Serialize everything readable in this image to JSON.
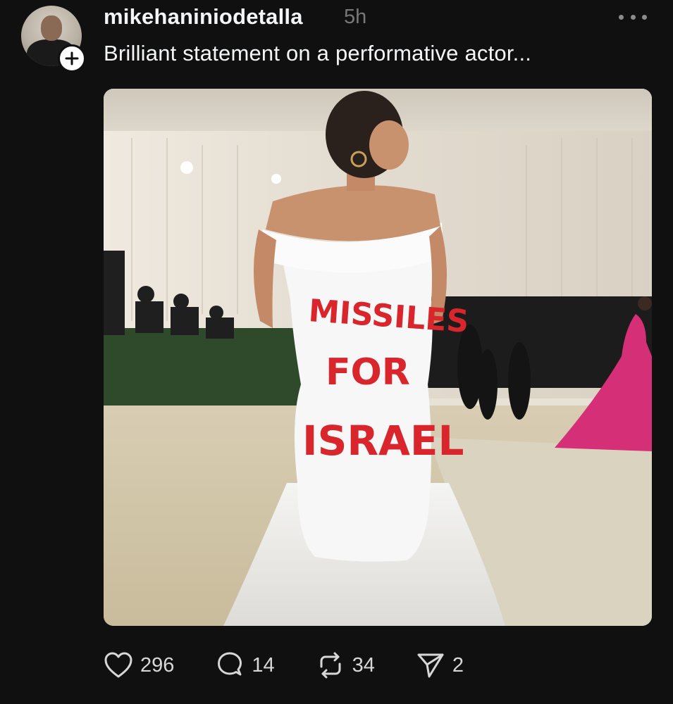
{
  "post": {
    "username": "mikehaniniodetalla",
    "time_ago": "5h",
    "caption": "Brilliant statement on a performative actor...",
    "image": {
      "dress_text_line1": "MISSILES",
      "dress_text_line2": "FOR",
      "dress_text_line3": "ISRAEL"
    }
  },
  "actions": {
    "likes": "296",
    "replies": "14",
    "reposts": "34",
    "shares": "2"
  },
  "icons": {
    "like": "heart-icon",
    "reply": "comment-bubble-icon",
    "repost": "repost-icon",
    "share": "send-icon",
    "more": "more-dots-icon",
    "follow": "plus-icon"
  },
  "colors": {
    "background": "#101010",
    "text_primary": "#f3f5f7",
    "text_secondary": "#777777",
    "dress_text": "#d8262c"
  }
}
